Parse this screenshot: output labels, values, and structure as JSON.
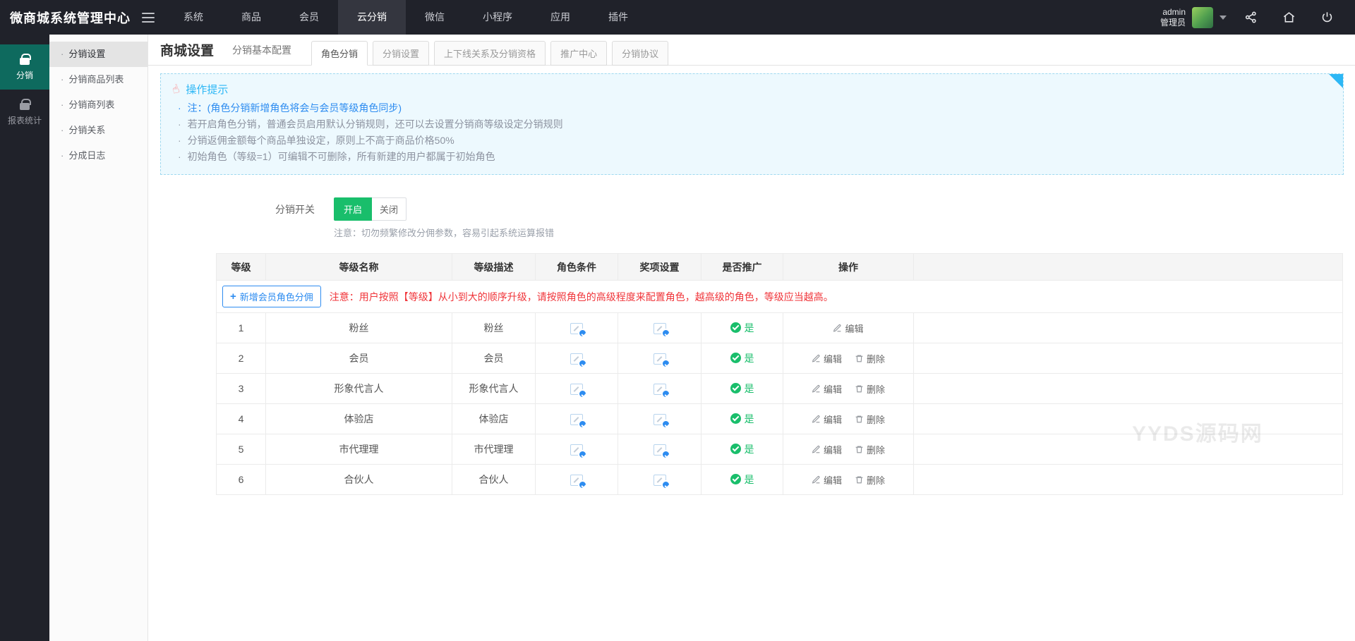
{
  "topbar": {
    "brand": "微商城系统管理中心",
    "menu": [
      {
        "label": "系统"
      },
      {
        "label": "商品"
      },
      {
        "label": "会员"
      },
      {
        "label": "云分销"
      },
      {
        "label": "微信"
      },
      {
        "label": "小程序"
      },
      {
        "label": "应用"
      },
      {
        "label": "插件"
      }
    ],
    "active_menu": "云分销",
    "user": {
      "name": "admin",
      "role": "管理员"
    }
  },
  "rail": {
    "items": [
      {
        "label": "分销"
      },
      {
        "label": "报表统计"
      }
    ],
    "active": "分销"
  },
  "sidebar": {
    "items": [
      {
        "label": "分销设置"
      },
      {
        "label": "分销商品列表"
      },
      {
        "label": "分销商列表"
      },
      {
        "label": "分销关系"
      },
      {
        "label": "分成日志"
      }
    ],
    "active": "分销设置"
  },
  "header": {
    "title": "商城设置",
    "basic_tab": "分销基本配置",
    "tabs": [
      {
        "label": "角色分销"
      },
      {
        "label": "分销设置"
      },
      {
        "label": "上下线关系及分销资格"
      },
      {
        "label": "推广中心"
      },
      {
        "label": "分销协议"
      }
    ],
    "active_tab": "角色分销"
  },
  "tips": {
    "title": "操作提示",
    "lines": [
      "注：(角色分销新增角色将会与会员等级角色同步)",
      "若开启角色分销，普通会员启用默认分销规则，还可以去设置分销商等级设定分销规则",
      "分销返佣金额每个商品单独设定，原则上不高于商品价格50%",
      "初始角色（等级=1）可编辑不可删除，所有新建的用户都属于初始角色"
    ]
  },
  "switch": {
    "label": "分销开关",
    "on": "开启",
    "off": "关闭",
    "state": "开启",
    "note": "注意：切勿频繁修改分佣参数，容易引起系统运算报错"
  },
  "table": {
    "headers": [
      "等级",
      "等级名称",
      "等级描述",
      "角色条件",
      "奖项设置",
      "是否推广",
      "操作"
    ],
    "add_button": "新增会员角色分佣",
    "warning": "注意：用户按照【等级】从小到大的顺序升级，请按照角色的高级程度来配置角色，越高级的角色，等级应当越高。",
    "promote_yes": "是",
    "edit_label": "编辑",
    "delete_label": "删除",
    "rows": [
      {
        "level": "1",
        "name": "粉丝",
        "desc": "粉丝",
        "promote": "是"
      },
      {
        "level": "2",
        "name": "会员",
        "desc": "会员",
        "promote": "是"
      },
      {
        "level": "3",
        "name": "形象代言人",
        "desc": "形象代言人",
        "promote": "是"
      },
      {
        "level": "4",
        "name": "体验店",
        "desc": "体验店",
        "promote": "是"
      },
      {
        "level": "5",
        "name": "市代理理",
        "desc": "市代理理",
        "promote": "是"
      },
      {
        "level": "6",
        "name": "合伙人",
        "desc": "合伙人",
        "promote": "是"
      }
    ]
  },
  "watermark": "YYDS源码网",
  "colors": {
    "topbar_bg": "#20222a",
    "rail_active": "#0e6a5e",
    "accent_blue": "#2d8cf0",
    "tip_blue": "#2db7f5",
    "green": "#19be6b",
    "red": "#f0353a"
  }
}
